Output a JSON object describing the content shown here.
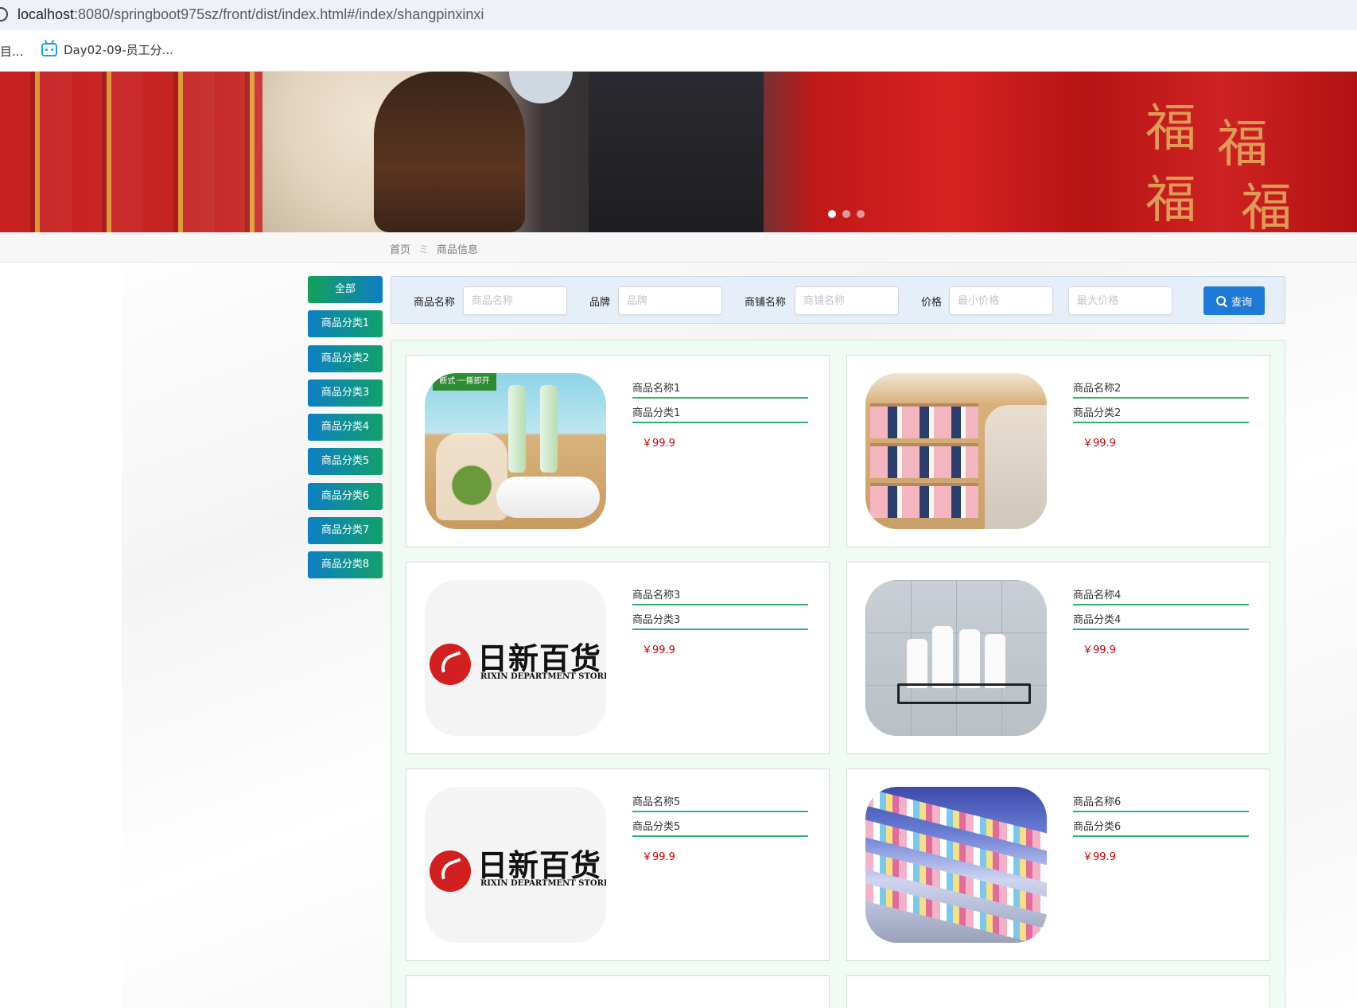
{
  "browser": {
    "url_host": "localhost",
    "url_rest": ":8080/springboot975sz/front/dist/index.html#/index/shangpinxinxi",
    "bookmarks": [
      {
        "label": "目..."
      },
      {
        "label": "Day02-09-员工分..."
      }
    ]
  },
  "breadcrumb": {
    "home": "首页",
    "separator": "ミ",
    "current": "商品信息"
  },
  "categories": [
    {
      "label": "全部",
      "active": true
    },
    {
      "label": "商品分类1"
    },
    {
      "label": "商品分类2"
    },
    {
      "label": "商品分类3"
    },
    {
      "label": "商品分类4"
    },
    {
      "label": "商品分类5"
    },
    {
      "label": "商品分类6"
    },
    {
      "label": "商品分类7"
    },
    {
      "label": "商品分类8"
    }
  ],
  "search": {
    "name_label": "商品名称",
    "name_placeholder": "商品名称",
    "brand_label": "品牌",
    "brand_placeholder": "品牌",
    "shop_label": "商铺名称",
    "shop_placeholder": "商铺名称",
    "price_label": "价格",
    "min_placeholder": "最小价格",
    "max_placeholder": "最大价格",
    "query_label": "查询"
  },
  "products": [
    {
      "name": "商品名称1",
      "category": "商品分类1",
      "price": "￥99.9",
      "image": "bags",
      "tag": "断式·一撕即开"
    },
    {
      "name": "商品名称2",
      "category": "商品分类2",
      "price": "￥99.9",
      "image": "shoes"
    },
    {
      "name": "商品名称3",
      "category": "商品分类3",
      "price": "￥99.9",
      "image": "logo"
    },
    {
      "name": "商品名称4",
      "category": "商品分类4",
      "price": "￥99.9",
      "image": "rack"
    },
    {
      "name": "商品名称5",
      "category": "商品分类5",
      "price": "￥99.9",
      "image": "logo"
    },
    {
      "name": "商品名称6",
      "category": "商品分类6",
      "price": "￥99.9",
      "image": "shop"
    }
  ],
  "logo": {
    "cn": "日新百货",
    "en": "RIXIN DEPARTMENT STORE"
  },
  "banner": {
    "characters": [
      "福",
      "福",
      "福",
      "福"
    ],
    "slides": 3,
    "active_slide": 0
  },
  "colors": {
    "accent_blue": "#1e7ad6",
    "accent_green": "#2fb36a",
    "price_red": "#c40000"
  }
}
